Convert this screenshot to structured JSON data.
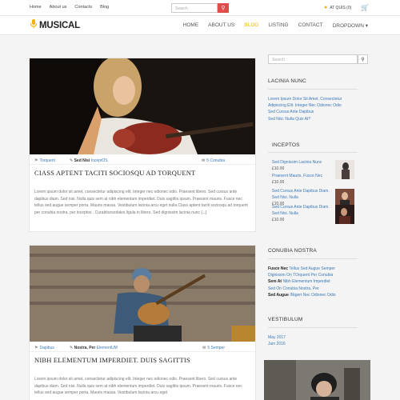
{
  "topbar": {
    "links": [
      "Home",
      "About us",
      "Contacts",
      "Blog"
    ],
    "search_placeholder": "Search",
    "account_label": "AT QUIS (0)"
  },
  "header": {
    "logo": "MUSICAL",
    "menu": [
      "HOME",
      "ABOUT US",
      "BLOG",
      "LISTING",
      "CONTACT",
      "DROPDOWN"
    ],
    "active": "BLOG"
  },
  "posts": [
    {
      "tag": "Torquent",
      "author_label": "Sed Nisi",
      "author": "InceptOS",
      "comments": "5 Conubia",
      "title": "CIASS APTENT TACITI SOCIOSQU AD TORQUENT",
      "excerpt": "Lorem ipsum dolor sit amet, consectetur adipiscing elit. Integer nec odionec odio. Praesent libero. Sed cursus ante dapibus diam. Sed nisi. Nulla quis sem at nibh elementum imperdiet. Duis sagittis ipsum. Praesent mauris. Fusce nec tellus sed augue semper porta. Mauris massa. Vestibulum lacinia arcu eget nulla.Class aptent taciti sociosqu ad torquent per conubia nostra, per inceptos . Curabitursodales ligula in libero. Sed dignissim lacinia nunc [...]"
    },
    {
      "tag": "Dapibus",
      "author_label": "Nostra, Per",
      "author": "ElementUM",
      "comments": "5 Semper",
      "title": "NIBH ELEMENTUM IMPERDIET. DUIS SAGITTIS",
      "excerpt": "Lorem ipsum dolor sit amet, consectetur adipiscing elit. Integer nec odionec odio. Praesent libero. Sed cursus ante dapibus diam. Sed nisi. Nulla quis sem at nibh elementum imperdiet. Duis sagittis ipsum. Praesent mauris. Fusce nec tellus sed augue semper porta. Mauris massa. Vestibulum lacinia arcu eget"
    }
  ],
  "sidebar": {
    "search_placeholder": "Search",
    "lacinia_title": "LACINIA NUNC",
    "lacinia_links": [
      "Lorem Ipsum Dolor Sit Amet, Consectetur",
      "Adipiscing Elit. Integer Nec Odionec Odio",
      "Sed Cursus Ante Dapibus",
      "Sed Nisi. Nulla Quis At?"
    ],
    "inceptos_title": "INCEPTOS",
    "inceptos_items": [
      {
        "name": "Sed Dignissim Lacinia Nunc",
        "price": "£10.00"
      },
      {
        "name": "Praesent Mauris. Fusce Nec",
        "price": "£10.00"
      },
      {
        "name": "Sed Cursus Ante Dapibus Diam. Sed Nisi. Nulla",
        "price": "£10.00"
      },
      {
        "name": "Sed Cursus Ante Dapibus Diam. Sed Nisi. Nulla",
        "price": "£10.00"
      }
    ],
    "conubia_title": "CONUBIA NOSTRA",
    "conubia_lines": [
      {
        "bold": "Fusce Nec",
        "link": "Tellus Sed Augue Semper"
      },
      {
        "bold": "",
        "link": "Dignissim On TOrquent Per Conubia"
      },
      {
        "bold": "Sem At",
        "link": "Nibh Elementum Imperdiet"
      },
      {
        "bold": "",
        "link": "Sed On Conubia Nostra, Per"
      },
      {
        "bold": "Sed Augue",
        "link": "INtgert Nec Odionec Odio"
      }
    ],
    "vestibulum_title": "VESTIBULUM",
    "archive": [
      "May 2017",
      "Juin 2016"
    ]
  },
  "colors": {
    "accent": "#f0b400",
    "link": "#3a79b8",
    "search_button": "#e04b4b"
  }
}
